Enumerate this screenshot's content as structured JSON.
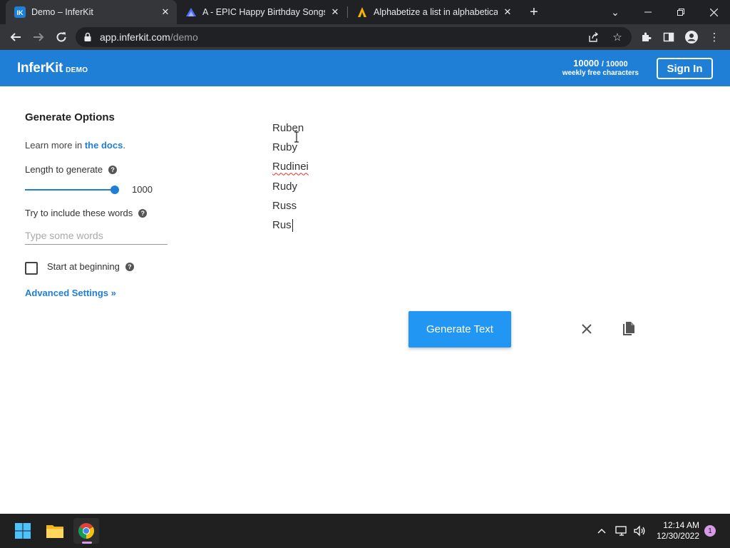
{
  "browser": {
    "tabs": [
      {
        "title": "Demo – InferKit",
        "favicon": "inferkit-logo-icon",
        "active": true
      },
      {
        "title": "A - EPIC Happy Birthday Songs!",
        "favicon": "mountain-icon",
        "active": false
      },
      {
        "title": "Alphabetize a list in alphabetical",
        "favicon": "a-logo-icon",
        "active": false
      }
    ],
    "url_host": "app.inferkit.com",
    "url_path": "/demo"
  },
  "header": {
    "logo": "InferKit",
    "logo_badge": "DEMO",
    "quota_used": "10000",
    "quota_max": "/ 10000",
    "quota_label": "weekly free characters",
    "signin_label": "Sign In",
    "brand_color": "#1f7fd6"
  },
  "options": {
    "title": "Generate Options",
    "learn_prefix": "Learn more in",
    "learn_link": "the docs",
    "learn_suffix": ".",
    "length_label": "Length to generate",
    "length_value": "1000",
    "length_fraction": 1.0,
    "words_label": "Try to include these words",
    "words_placeholder": "Type some words",
    "start_label": "Start at beginning",
    "start_checked": false,
    "advanced_label": "Advanced Settings »"
  },
  "editor": {
    "lines": [
      "Ruben",
      "Ruby",
      "Rudinei",
      "Rudy",
      "Russ",
      "Rus"
    ],
    "misspelled_index": 2
  },
  "actions": {
    "generate_label": "Generate Text",
    "clear_icon": "close-icon",
    "copy_icon": "copy-icon",
    "accent_color": "#2196f3"
  },
  "taskbar": {
    "time": "12:14 AM",
    "date": "12/30/2022",
    "notification_count": "1"
  }
}
